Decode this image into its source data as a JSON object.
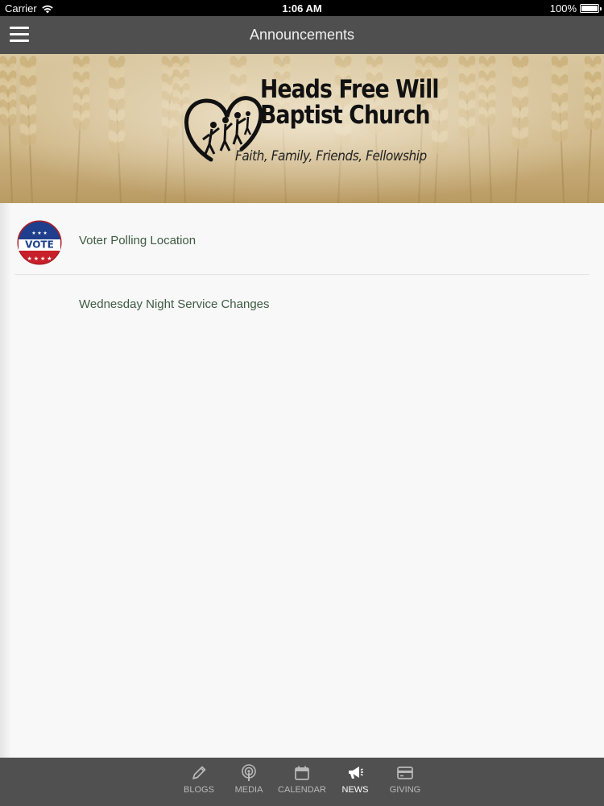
{
  "status_bar": {
    "carrier": "Carrier",
    "time": "1:06 AM",
    "battery": "100%"
  },
  "nav": {
    "title": "Announcements"
  },
  "banner": {
    "church_name_line1": "Heads Free Will",
    "church_name_line2": "Baptist Church",
    "tagline": "Faith, Family, Friends, Fellowship"
  },
  "announcements": [
    {
      "title": "Voter Polling Location",
      "thumb_text": "VOTE"
    },
    {
      "title": "Wednesday Night Service Changes"
    }
  ],
  "tabs": [
    {
      "label": "BLOGS",
      "icon": "pencil-icon",
      "active": false
    },
    {
      "label": "MEDIA",
      "icon": "podcast-icon",
      "active": false
    },
    {
      "label": "CALENDAR",
      "icon": "calendar-icon",
      "active": false
    },
    {
      "label": "NEWS",
      "icon": "megaphone-icon",
      "active": true
    },
    {
      "label": "GIVING",
      "icon": "credit-card-icon",
      "active": false
    }
  ],
  "colors": {
    "nav_background": "#4f4f4f",
    "tab_background": "#505050",
    "item_text": "#3e5c42",
    "active_tab": "#ffffff",
    "inactive_tab": "#b9b9b9"
  }
}
